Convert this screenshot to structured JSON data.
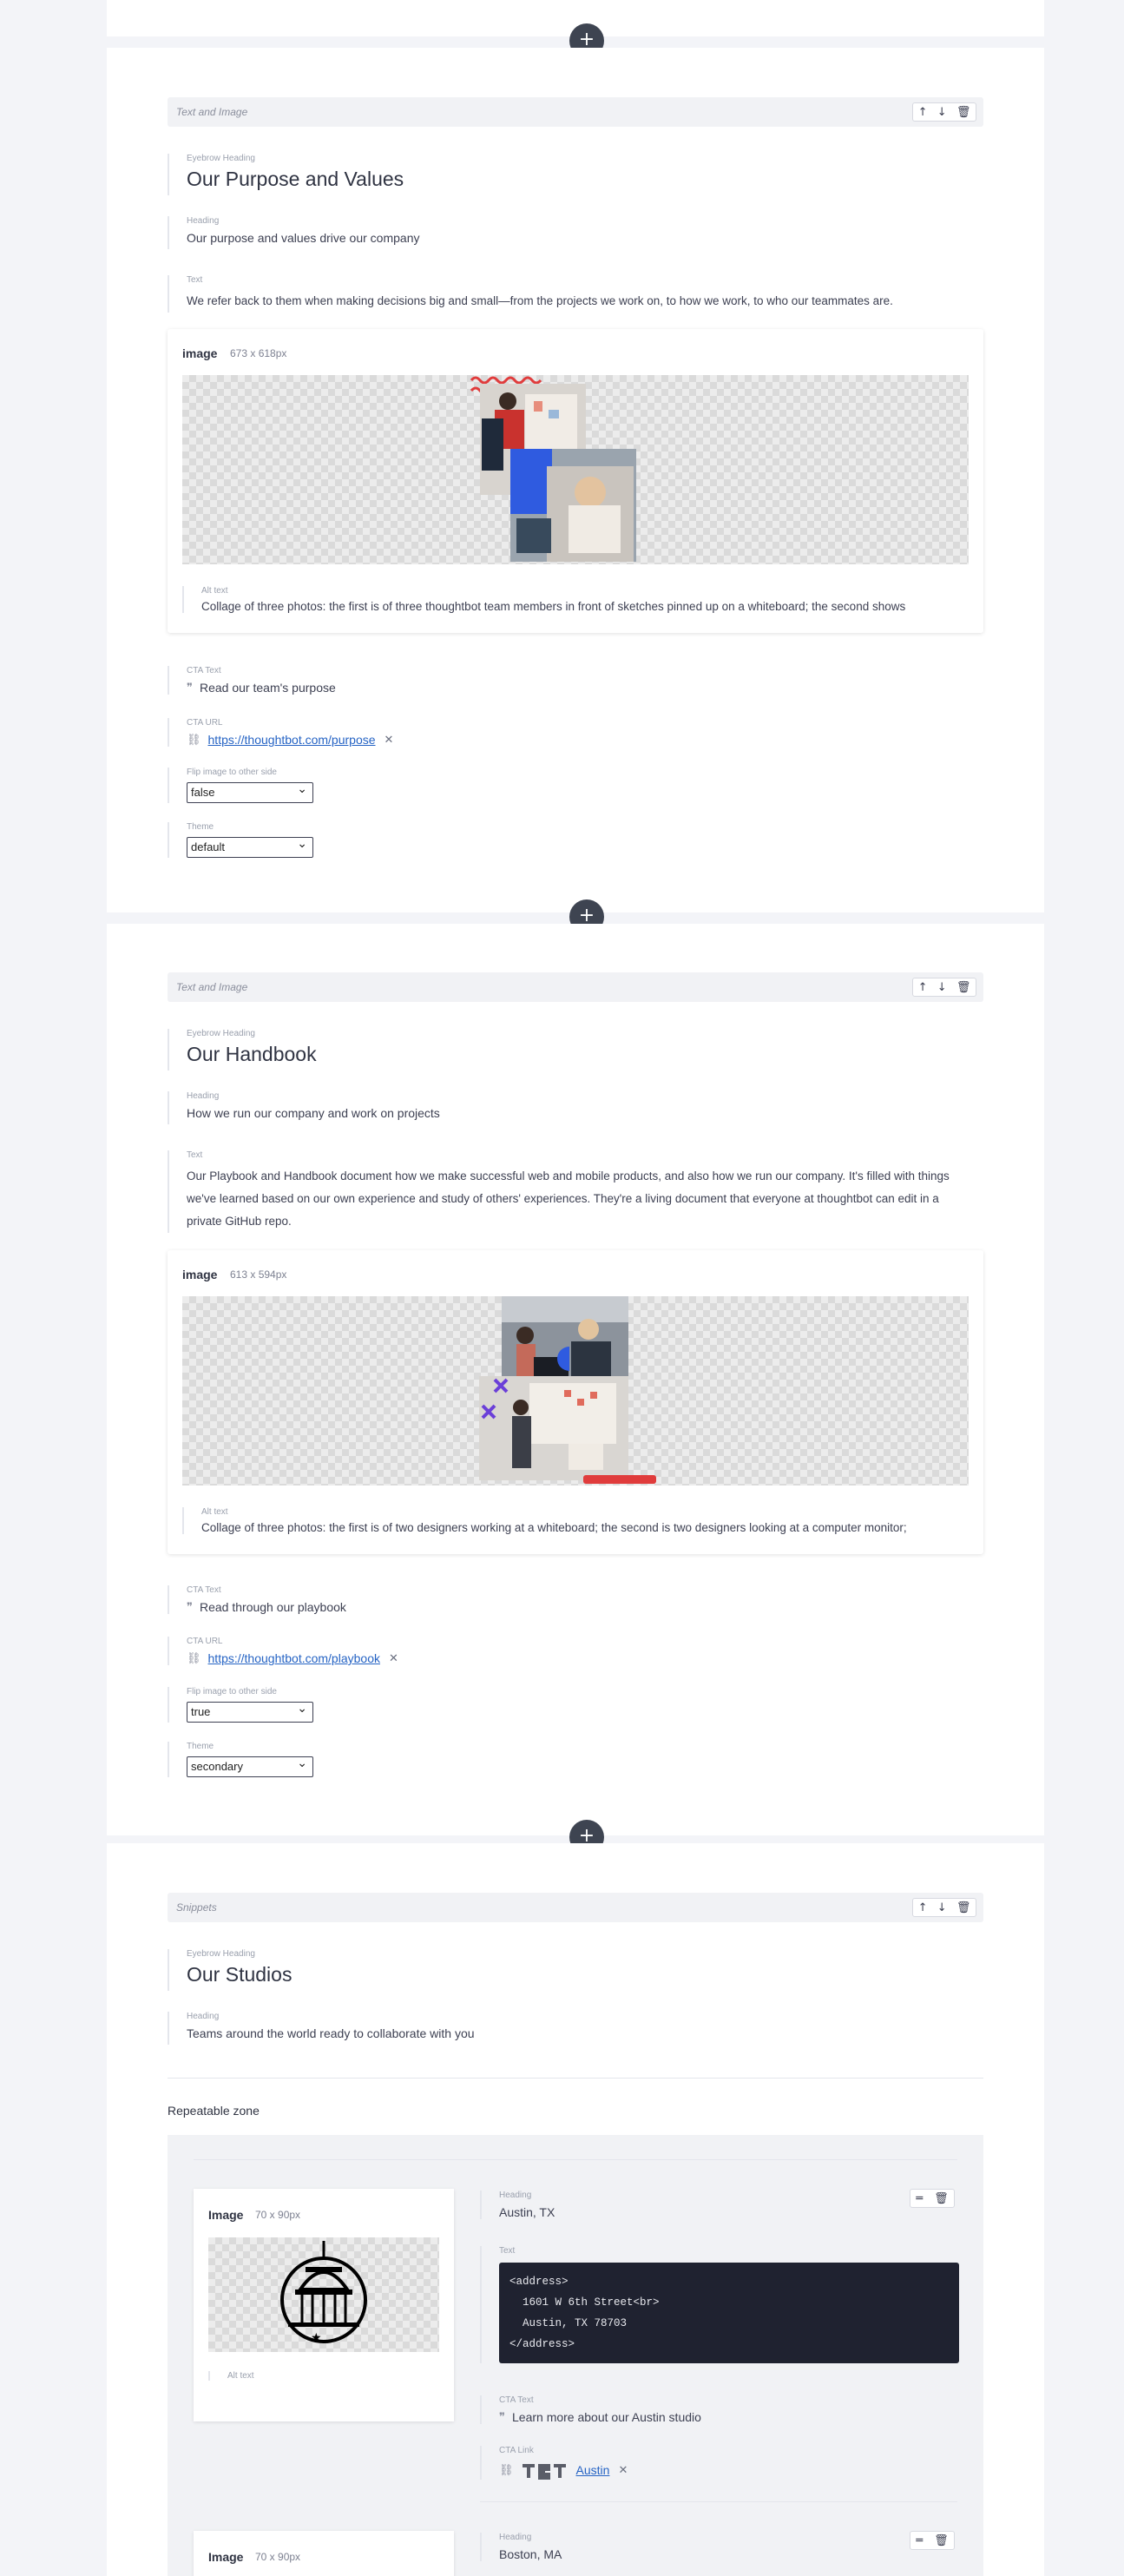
{
  "add_block_label": "+",
  "sections": [
    {
      "block_type": "Text and Image",
      "controls": [
        "↑",
        "↓",
        "🗑"
      ],
      "eyebrow_label": "Eyebrow Heading",
      "eyebrow": "Our Purpose and Values",
      "heading_label": "Heading",
      "heading": "Our purpose and values drive our company",
      "text_label": "Text",
      "text": "We refer back to them when making decisions big and small—from the projects we work on, to how we work, to who our teammates are.",
      "image_title": "image",
      "image_size": "673 x 618px",
      "alt_label": "Alt text",
      "alt": "Collage of three photos: the first is of three thoughtbot team members in front of sketches pinned up on a whiteboard; the second shows",
      "cta_text_label": "CTA Text",
      "cta_text": "Read our team's purpose",
      "cta_url_label": "CTA URL",
      "cta_url": "https://thoughtbot.com/purpose",
      "flip_label": "Flip image to other side",
      "flip": "false",
      "theme_label": "Theme",
      "theme": "default"
    },
    {
      "block_type": "Text and Image",
      "controls": [
        "↑",
        "↓",
        "🗑"
      ],
      "eyebrow_label": "Eyebrow Heading",
      "eyebrow": "Our Handbook",
      "heading_label": "Heading",
      "heading": "How we run our company and work on projects",
      "text_label": "Text",
      "text": "Our Playbook and Handbook document how we make successful web and mobile products, and also how we run our company. It's filled with things we've learned based on our own experience and study of others' experiences. They're a living document that everyone at thoughtbot can edit in a private GitHub repo.",
      "image_title": "image",
      "image_size": "613 x 594px",
      "alt_label": "Alt text",
      "alt": "Collage of three photos: the first is of two designers working at a whiteboard; the second is two designers looking at a computer monitor;",
      "cta_text_label": "CTA Text",
      "cta_text": "Read through our playbook",
      "cta_url_label": "CTA URL",
      "cta_url": "https://thoughtbot.com/playbook",
      "flip_label": "Flip image to other side",
      "flip": "true",
      "theme_label": "Theme",
      "theme": "secondary"
    }
  ],
  "snippets": {
    "block_type": "Snippets",
    "controls": [
      "↑",
      "↓",
      "🗑"
    ],
    "eyebrow_label": "Eyebrow Heading",
    "eyebrow": "Our Studios",
    "heading_label": "Heading",
    "heading": "Teams around the world ready to collaborate with you",
    "repeatable_zone_label": "Repeatable zone",
    "items": [
      {
        "image_title": "Image",
        "image_size": "70 x 90px",
        "alt_label": "Alt text",
        "controls": [
          "═",
          "🗑"
        ],
        "heading_label": "Heading",
        "heading": "Austin, TX",
        "text_label": "Text",
        "code": "<address>\n  1601 W 6th Street<br>\n  Austin, TX 78703\n</address>",
        "cta_text_label": "CTA Text",
        "cta_text": "Learn more  about our Austin studio",
        "cta_link_label": "CTA Link",
        "cta_link": "Austin"
      },
      {
        "image_title": "Image",
        "image_size": "70 x 90px",
        "controls": [
          "═",
          "🗑"
        ],
        "heading_label": "Heading",
        "heading": "Boston, MA"
      }
    ]
  },
  "colors": {
    "page_bg": "#f3f4f8",
    "accent_link": "#2563c4",
    "plus_button": "#3e4451",
    "code_bg": "#1f2230",
    "collage_red": "#e03c3c",
    "collage_blue": "#2f5be0",
    "collage_purple": "#6b3fd8"
  }
}
